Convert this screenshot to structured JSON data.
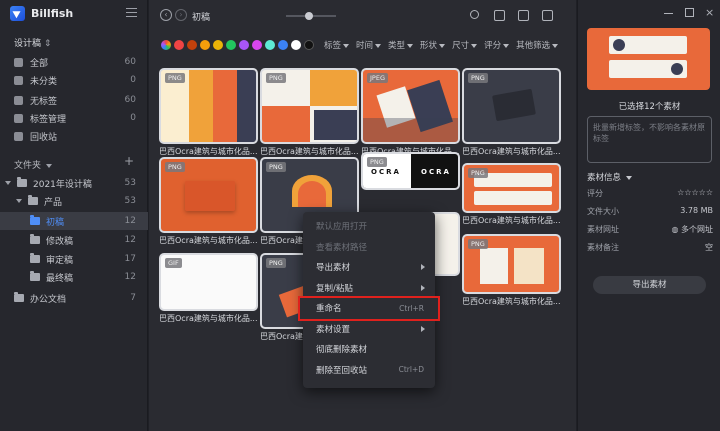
{
  "app": {
    "name": "Billfish"
  },
  "sidebar": {
    "library": "设计稿",
    "nav": [
      {
        "label": "全部",
        "count": "60"
      },
      {
        "label": "未分类",
        "count": "0"
      },
      {
        "label": "无标签",
        "count": "60"
      },
      {
        "label": "标签管理",
        "count": "0"
      },
      {
        "label": "回收站",
        "count": ""
      }
    ],
    "folders_title": "文件夹",
    "folders_add": "+",
    "tree": [
      {
        "label": "2021年设计稿",
        "count": "53"
      },
      {
        "label": "产品",
        "count": "53"
      },
      {
        "label": "初稿",
        "count": "12"
      },
      {
        "label": "修改稿",
        "count": "12"
      },
      {
        "label": "审定稿",
        "count": "17"
      },
      {
        "label": "最终稿",
        "count": "12"
      },
      {
        "label": "办公文档",
        "count": "7"
      }
    ]
  },
  "topbar": {
    "back": "‹",
    "forward": "›",
    "breadcrumb": "初稿"
  },
  "filters": {
    "colors": [
      "#ef4444",
      "#c2410c",
      "#f59e0b",
      "#eab308",
      "#22c55e",
      "#a855f7",
      "#d946ef",
      "#5eead4",
      "#3b82f6",
      "#ffffff",
      "#111111"
    ],
    "items": [
      "标签",
      "时间",
      "类型",
      "形状",
      "尺寸",
      "评分",
      "其他筛选"
    ]
  },
  "grid": {
    "items": [
      {
        "format": "PNG",
        "caption": "巴西Ocra建筑与城市化品..."
      },
      {
        "format": "PNG",
        "caption": "巴西Ocra建筑与城市化品..."
      },
      {
        "format": "JPEG",
        "caption": "巴西Ocra建筑与城市化品..."
      },
      {
        "format": "PNG",
        "caption": "巴西Ocra建筑与城市化品..."
      },
      {
        "format": "PNG",
        "caption": "巴西Ocra建筑与城市化品..."
      },
      {
        "format": "PNG",
        "caption": "巴西Ocra建筑与城市化品..."
      },
      {
        "format": "PNG",
        "caption": ""
      },
      {
        "format": "PNG",
        "caption": "巴西Ocra建筑与城市化品..."
      },
      {
        "format": "GIF",
        "caption": "巴西Ocra建筑与城市化品..."
      },
      {
        "format": "PNG",
        "caption": "巴西Ocra建筑与城市化品..."
      },
      {
        "format": "PNG",
        "caption": "巴西Ocra建筑与城市化品..."
      }
    ],
    "logo_text": "OCRA"
  },
  "context_menu": {
    "items": [
      {
        "label": "默认应用打开",
        "shortcut": ""
      },
      {
        "label": "查看素材路径",
        "shortcut": ""
      },
      {
        "label": "导出素材",
        "shortcut": ""
      },
      {
        "label": "复制/粘贴",
        "shortcut": ""
      },
      {
        "label": "重命名",
        "shortcut": "Ctrl+R"
      },
      {
        "label": "素材设置",
        "shortcut": ""
      },
      {
        "label": "彻底删除素材",
        "shortcut": ""
      },
      {
        "label": "删除至回收站",
        "shortcut": "Ctrl+D"
      }
    ]
  },
  "panel": {
    "selected": "已选择12个素材",
    "tag_placeholder": "批量新增标签，不影响各素材原标签",
    "info_title": "素材信息",
    "rows": [
      {
        "label": "评分",
        "value": "☆☆☆☆☆"
      },
      {
        "label": "文件大小",
        "value": "3.78 MB"
      },
      {
        "label": "素材网址",
        "value": "多个网址"
      },
      {
        "label": "素材备注",
        "value": "空"
      }
    ],
    "export_label": "导出素材"
  }
}
